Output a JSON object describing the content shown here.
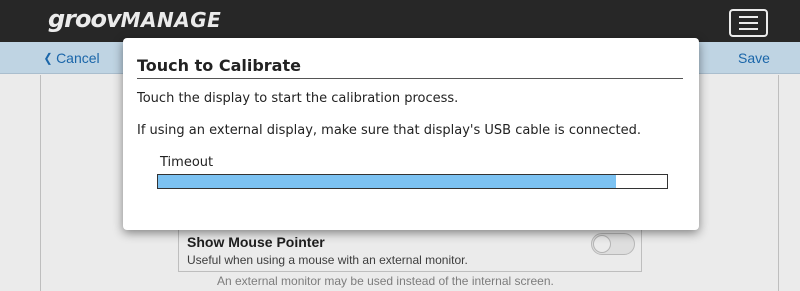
{
  "app": {
    "logo_groov": "groov",
    "logo_manage": "MANAGE",
    "menu_icon": "hamburger-menu-icon"
  },
  "nav": {
    "cancel_label": "Cancel",
    "cancel_icon": "chevron-left-icon",
    "save_label": "Save"
  },
  "background_setting": {
    "title": "Show Mouse Pointer",
    "description": "Useful when using a mouse with an external monitor.",
    "toggle_on": false,
    "footnote": "An external monitor may be used instead of the internal screen."
  },
  "dialog": {
    "title": "Touch to Calibrate",
    "line1": "Touch the display to start the calibration process.",
    "line2": "If using an external display, make sure that display's USB cable is connected.",
    "timeout_label": "Timeout",
    "timeout_remaining_fraction": 0.9
  },
  "colors": {
    "topbar": "#2b2b2b",
    "navbar": "#d0e6f7",
    "link": "#1d6fb8",
    "progress": "#7cc2f2"
  }
}
